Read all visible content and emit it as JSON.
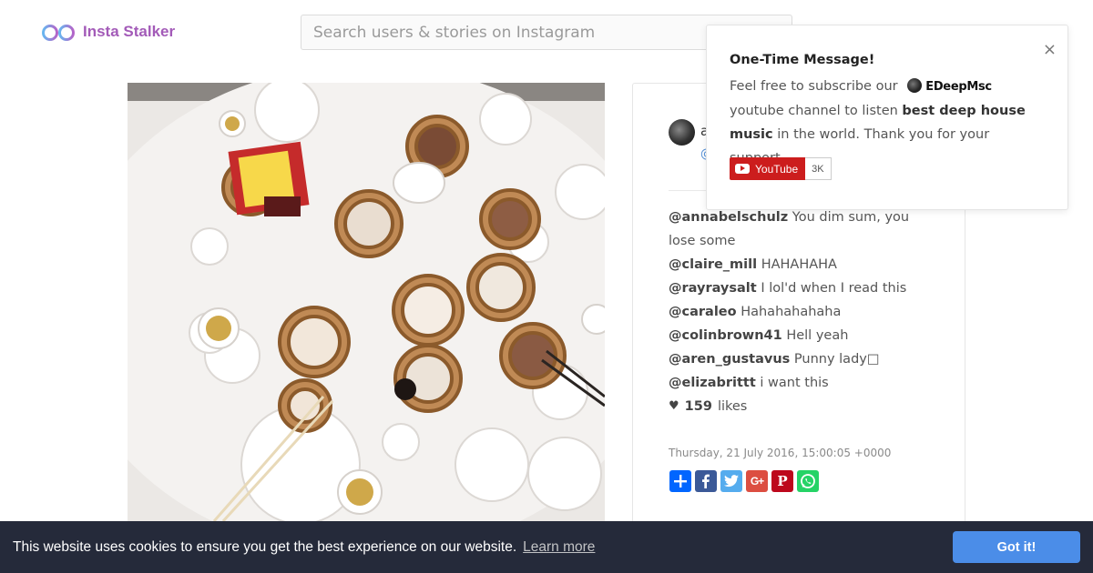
{
  "header": {
    "brand": "Insta Stalker",
    "search_placeholder": "Search users & stories on Instagram",
    "brand_color": "#a35bb8"
  },
  "post": {
    "author_partial": "a",
    "handle_partial": "@",
    "comments": [
      {
        "handle": "@annabelschulz",
        "text": "You dim sum, you lose some"
      },
      {
        "handle": "@claire_mill",
        "text": "HAHAHAHA"
      },
      {
        "handle": "@rayraysalt",
        "text": "I lol'd when I read this"
      },
      {
        "handle": "@caraleo",
        "text": "Hahahahahaha"
      },
      {
        "handle": "@colinbrown41",
        "text": "Hell yeah"
      },
      {
        "handle": "@aren_gustavus",
        "text": "Punny lady□"
      },
      {
        "handle": "@elizabrittt",
        "text": "i want this"
      }
    ],
    "likes_count": "159",
    "likes_label": "likes",
    "timestamp": "Thursday, 21 July 2016, 15:00:05 +0000",
    "share_icons": [
      "add-share-icon",
      "facebook-icon",
      "twitter-icon",
      "google-plus-icon",
      "pinterest-icon",
      "whatsapp-icon"
    ]
  },
  "popup": {
    "title": "One-Time Message!",
    "close": "×",
    "text_before": "Feel free to subscribe our",
    "channel_name": "EDeepMsc",
    "text_mid": "youtube channel to listen",
    "bold_phrase": "best deep house music",
    "text_after": "in the world. Thank you for your support.",
    "youtube_label": "YouTube",
    "youtube_count": "3K"
  },
  "cookie": {
    "message": "This website uses cookies to ensure you get the best experience on our website.",
    "link": "Learn more",
    "button": "Got it!",
    "button_color": "#4b8de8",
    "bar_color": "#252a3a"
  }
}
